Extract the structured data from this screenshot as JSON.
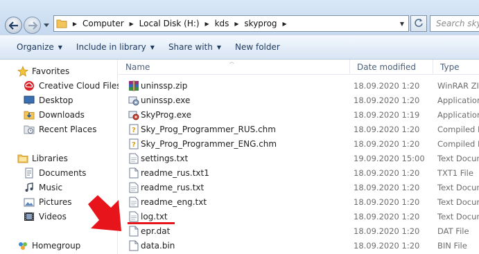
{
  "address": {
    "crumbs": [
      "Computer",
      "Local Disk (H:)",
      "kds",
      "skyprog"
    ],
    "search_placeholder": "Search skyp"
  },
  "toolbar": {
    "organize": "Organize",
    "include_in_library": "Include in library",
    "share_with": "Share with",
    "new_folder": "New folder"
  },
  "nav": {
    "favorites": "Favorites",
    "creative_cloud": "Creative Cloud Files",
    "desktop": "Desktop",
    "downloads": "Downloads",
    "recent_places": "Recent Places",
    "libraries": "Libraries",
    "documents": "Documents",
    "music": "Music",
    "pictures": "Pictures",
    "videos": "Videos",
    "homegroup": "Homegroup"
  },
  "columns": {
    "name": "Name",
    "date_modified": "Date modified",
    "type": "Type"
  },
  "files": [
    {
      "name": "uninssp.zip",
      "date": "18.09.2020 1:20",
      "type": "WinRAR ZIP",
      "icon": "winrar-zip-icon"
    },
    {
      "name": "uninssp.exe",
      "date": "18.09.2020 1:20",
      "type": "Application",
      "icon": "exe-app-icon"
    },
    {
      "name": "SkyProg.exe",
      "date": "18.09.2020 1:19",
      "type": "Application",
      "icon": "exe-app-icon"
    },
    {
      "name": "Sky_Prog_Programmer_RUS.chm",
      "date": "18.09.2020 1:20",
      "type": "Compiled H",
      "icon": "chm-help-icon"
    },
    {
      "name": "Sky_Prog_Programmer_ENG.chm",
      "date": "18.09.2020 1:20",
      "type": "Compiled H",
      "icon": "chm-help-icon"
    },
    {
      "name": "settings.txt",
      "date": "19.09.2020 15:00",
      "type": "Text Docum",
      "icon": "text-file-icon"
    },
    {
      "name": "readme_rus.txt1",
      "date": "18.09.2020 1:20",
      "type": "TXT1 File",
      "icon": "generic-file-icon"
    },
    {
      "name": "readme_rus.txt",
      "date": "18.09.2020 1:20",
      "type": "Text Docum",
      "icon": "text-file-icon"
    },
    {
      "name": "readme_eng.txt",
      "date": "18.09.2020 1:20",
      "type": "Text Docum",
      "icon": "text-file-icon"
    },
    {
      "name": "log.txt",
      "date": "18.09.2020 1:20",
      "type": "Text Docum",
      "icon": "text-file-icon"
    },
    {
      "name": "epr.dat",
      "date": "18.09.2020 1:20",
      "type": "DAT File",
      "icon": "generic-file-icon"
    },
    {
      "name": "data.bin",
      "date": "18.09.2020 1:20",
      "type": "BIN File",
      "icon": "generic-file-icon"
    }
  ],
  "colors": {
    "annotation": "#e8141b",
    "toolbar_text": "#1e395b",
    "header_text": "#4c607a"
  }
}
